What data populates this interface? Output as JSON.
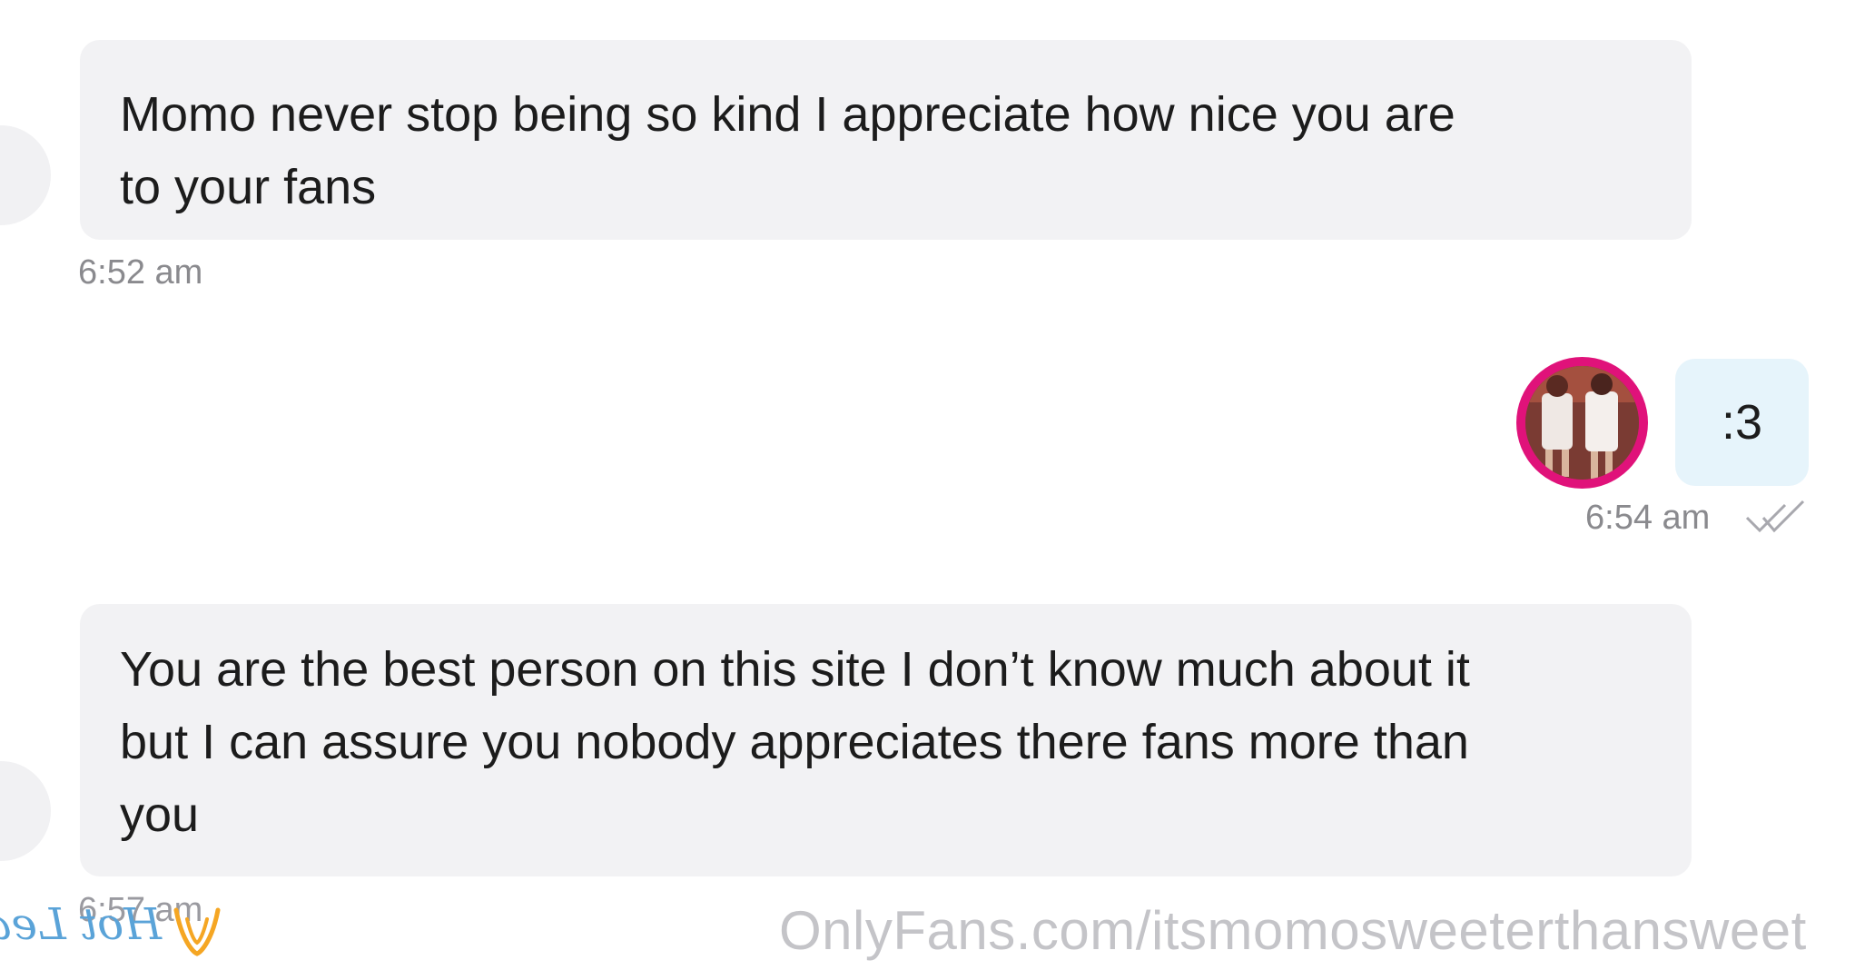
{
  "messages": [
    {
      "direction": "incoming",
      "text_lines": [
        "Momo never stop being so kind I appreciate how nice you are",
        "to your fans"
      ],
      "time": "6:52 am"
    },
    {
      "direction": "outgoing",
      "text": ":3",
      "time": "6:54 am",
      "status_icon": "double-check-icon"
    },
    {
      "direction": "incoming",
      "text_lines": [
        "You are the best person on this site I don’t know much about it",
        "but I can assure you nobody appreciates there fans more than",
        "you"
      ],
      "time": "6:57 am"
    }
  ],
  "watermark": "OnlyFans.com/itsmomosweeterthansweet",
  "logo": {
    "text": "Hot Leak",
    "icon": "hotleak-logo-icon"
  },
  "colors": {
    "incoming_bubble": "#f2f2f4",
    "outgoing_bubble": "#e6f4fb",
    "avatar_ring": "#e0127a",
    "timestamp": "#8a8a8e",
    "watermark": "#c4c4c8",
    "logo_blue": "#5aa3d8",
    "logo_orange": "#f5a623"
  }
}
